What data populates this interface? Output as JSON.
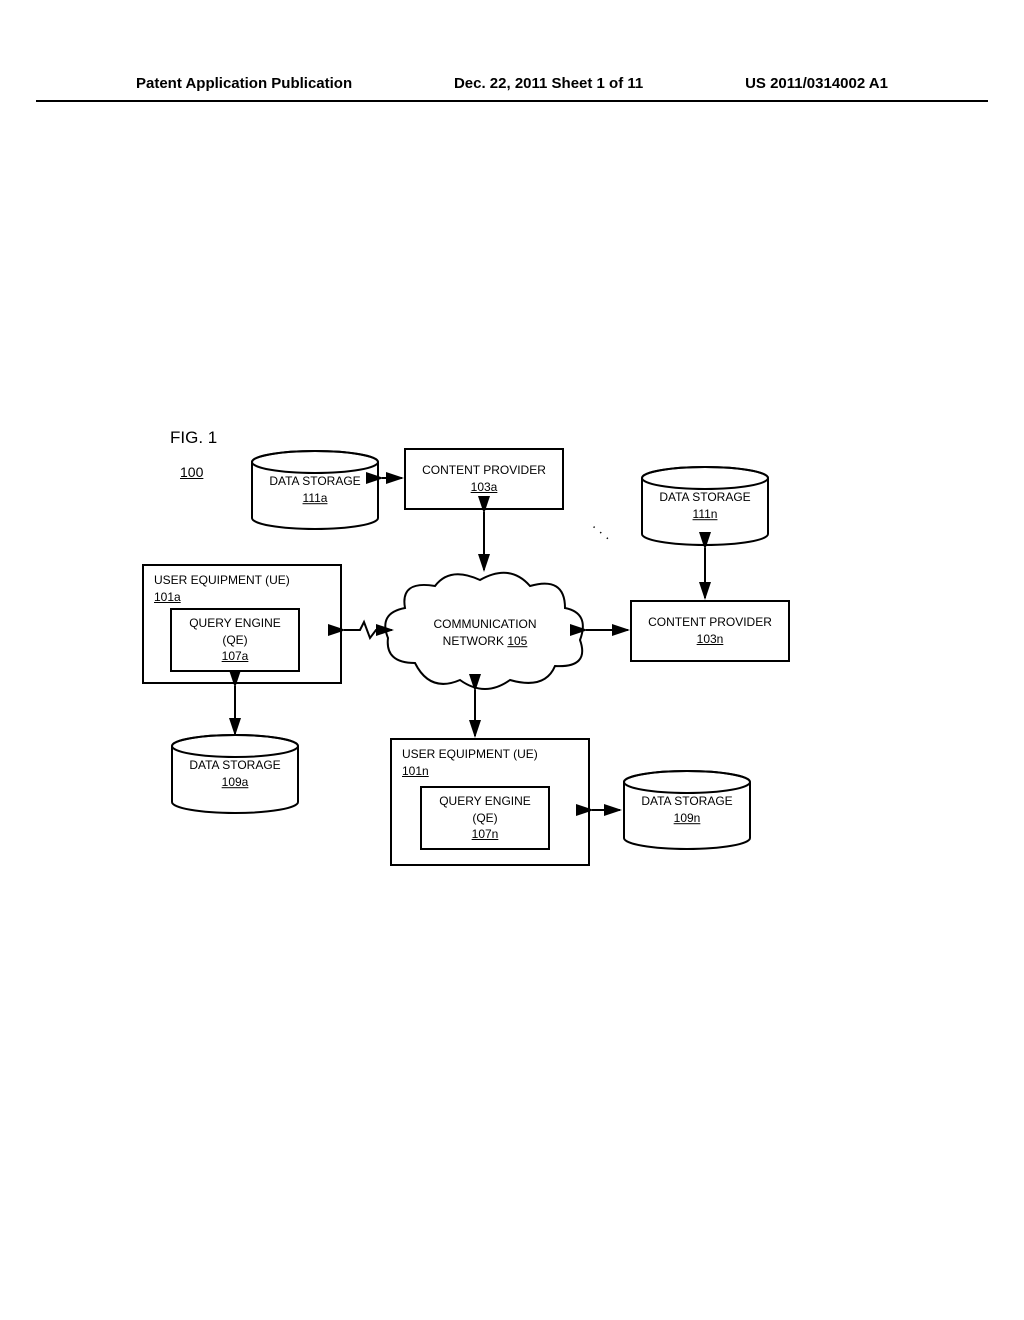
{
  "header": {
    "left": "Patent Application Publication",
    "center": "Dec. 22, 2011  Sheet 1 of 11",
    "right": "US 2011/0314002 A1"
  },
  "figure": {
    "label": "FIG. 1",
    "ref": "100"
  },
  "nodes": {
    "content_provider_a": {
      "title": "CONTENT PROVIDER",
      "ref": "103a"
    },
    "content_provider_n": {
      "title": "CONTENT PROVIDER",
      "ref": "103n"
    },
    "ue_a": {
      "title": "USER EQUIPMENT (UE)",
      "ref": "101a"
    },
    "ue_n": {
      "title": "USER EQUIPMENT (UE)",
      "ref": "101n"
    },
    "qe_a": {
      "title": "QUERY ENGINE",
      "sub": "(QE)",
      "ref": "107a"
    },
    "qe_n": {
      "title": "QUERY ENGINE",
      "sub": "(QE)",
      "ref": "107n"
    },
    "ds_111a": {
      "title": "DATA STORAGE",
      "ref": "111a"
    },
    "ds_111n": {
      "title": "DATA STORAGE",
      "ref": "111n"
    },
    "ds_109a": {
      "title": "DATA STORAGE",
      "ref": "109a"
    },
    "ds_109n": {
      "title": "DATA STORAGE",
      "ref": "109n"
    },
    "network": {
      "title": "COMMUNICATION",
      "sub": "NETWORK ",
      "ref": "105"
    }
  }
}
